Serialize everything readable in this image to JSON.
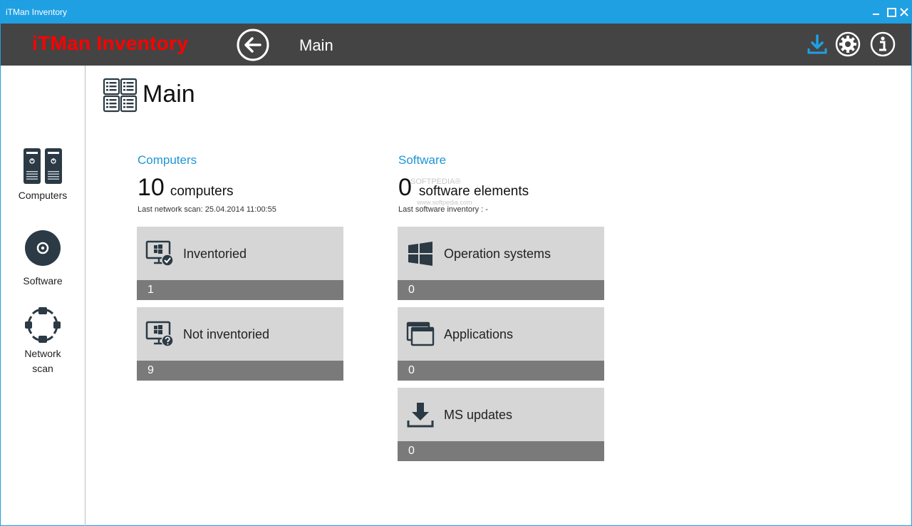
{
  "window": {
    "title": "iTMan Inventory"
  },
  "header": {
    "brand": "iTMan Inventory",
    "title": "Main"
  },
  "sidebar": {
    "items": [
      {
        "label": "Computers"
      },
      {
        "label": "Software"
      },
      {
        "label_line1": "Network",
        "label_line2": "scan"
      }
    ]
  },
  "main": {
    "title": "Main",
    "computers": {
      "section_title": "Computers",
      "count": "10",
      "count_unit": "computers",
      "note": "Last network scan: 25.04.2014 11:00:55",
      "tiles": [
        {
          "label": "Inventoried",
          "count": "1"
        },
        {
          "label": "Not inventoried",
          "count": "9"
        }
      ]
    },
    "software": {
      "section_title": "Software",
      "count": "0",
      "count_unit": "software elements",
      "note": "Last software inventory : -",
      "tiles": [
        {
          "label": "Operation systems",
          "count": "0"
        },
        {
          "label": "Applications",
          "count": "0"
        },
        {
          "label": "MS updates",
          "count": "0"
        }
      ]
    }
  },
  "watermark": {
    "text": "SOFTPEDIA®",
    "url": "www.softpedia.com"
  },
  "colors": {
    "titlebar": "#1fa0e3",
    "header": "#444444",
    "brand": "#ff0000",
    "accent": "#1e96d6",
    "tile": "#d6d6d6",
    "tile_footer": "#7a7a7a"
  }
}
